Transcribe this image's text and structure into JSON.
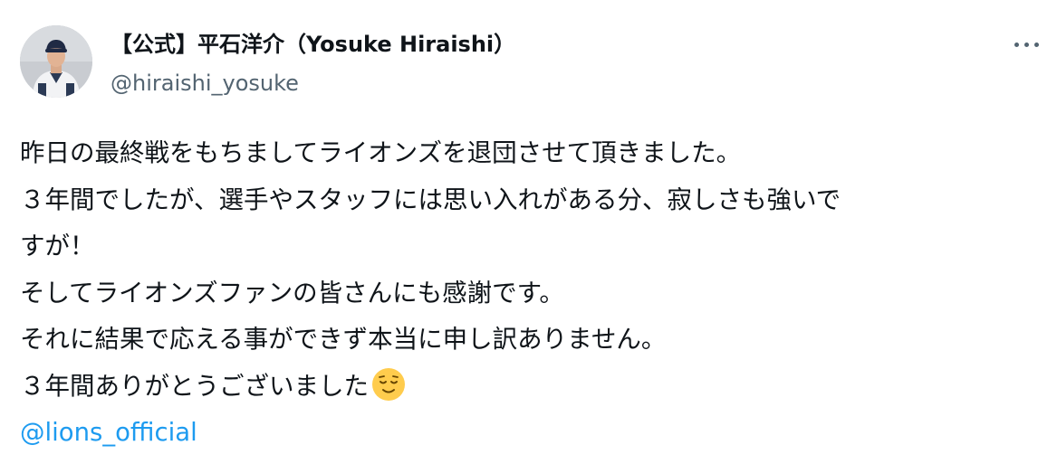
{
  "author": {
    "display_name": "【公式】平石洋介（Yosuke Hiraishi）",
    "handle": "@hiraishi_yosuke",
    "avatar_icon": "profile-photo-baseball-player"
  },
  "more_menu_icon": "more-horizontal-icon",
  "tweet": {
    "lines": [
      "昨日の最終戦をもちましてライオンズを退団させて頂きました。",
      "３年間でしたが、選手やスタッフには思い入れがある分、寂しさも強いで",
      "すが！",
      "そしてライオンズファンの皆さんにも感謝です。",
      "それに結果で応える事ができず本当に申し訳ありません。",
      "３年間ありがとうございました"
    ],
    "emoji_icon": "relieved-face-emoji",
    "mention": "@lions_official"
  },
  "colors": {
    "text": "#0f1419",
    "secondary": "#536471",
    "link": "#1d9bf0"
  }
}
